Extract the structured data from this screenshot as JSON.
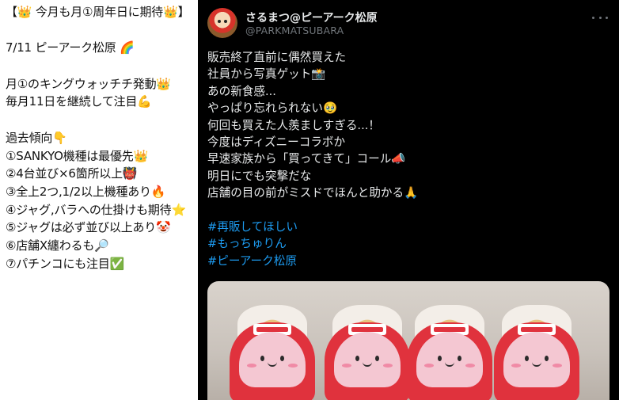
{
  "left_note": {
    "lines": [
      "【👑 今月も月①周年日に期待👑】",
      "",
      "7/11 ピーアーク松原 🌈",
      "",
      "月①のキングウォッチチ発動👑",
      "毎月11日を継続して注目💪",
      "",
      "過去傾向👇",
      "①SANKYO機種は最優先👑",
      "②4台並び×6箇所以上👹",
      "③全上2つ,1/2以上機種あり🔥",
      "④ジャグ,バラへの仕掛けも期待⭐",
      "⑤ジャグは必ず並び以上あり🤡",
      "⑥店舗X纏わるも🔎",
      "⑦パチンコにも注目✅"
    ]
  },
  "tweet": {
    "display_name": "さるまつ@ピーアーク松原",
    "handle": "@PARKMATSUBARA",
    "more_icon": "more-horizontal-icon",
    "body_lines": [
      "販売終了直前に偶然買えた",
      "社員から写真ゲット📸",
      "あの新食感...",
      "やっぱり忘れられない🥹",
      "何回も買えた人羨ましすぎる...！",
      "今度はディズニーコラボか",
      "早速家族から「買ってきて」コール📣",
      "明日にでも突撃だな",
      "店舗の目の前がミスドでほんと助かる🙏"
    ],
    "hashtags": [
      "#再販してほしい",
      "#もっちゅりん",
      "#ピーアーク松原"
    ],
    "photo": {
      "pack_count": 4,
      "colors": {
        "pack": "#e0323d",
        "face": "#f4c7d2"
      }
    }
  },
  "colors": {
    "tweet_bg": "#000000",
    "text": "#e7e9ea",
    "muted": "#71767b",
    "hashtag": "#1d9bf0"
  }
}
